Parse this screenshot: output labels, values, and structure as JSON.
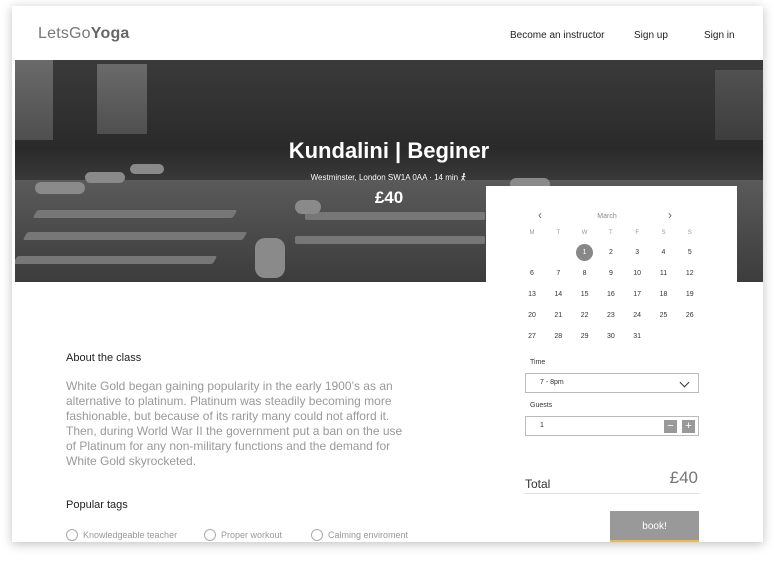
{
  "header": {
    "logo_light": "LetsGo",
    "logo_bold": "Yoga",
    "nav": [
      {
        "label": "Become an instructor"
      },
      {
        "label": "Sign up"
      },
      {
        "label": "Sign in"
      }
    ]
  },
  "hero": {
    "title": "Kundalini | Beginer",
    "location": "Westminster, London SW1A 0AA · 14 min",
    "price": "£40"
  },
  "about": {
    "heading": "About the class",
    "text": "White Gold began gaining popularity in the early 1900’s as an alternative to platinum. Platinum was steadily becoming more fashionable, but because of its rarity many could not afford it. Then, during World War II the government put a ban on the use of Platinum for any non-military functions and the demand for White Gold skyrocketed."
  },
  "tags": {
    "heading": "Popular tags",
    "items": [
      {
        "label": "Knowledgeable teacher",
        "icon": "chat-icon"
      },
      {
        "label": "Proper workout",
        "icon": "dumbbell-icon"
      },
      {
        "label": "Calming enviroment",
        "icon": "leaf-icon"
      }
    ]
  },
  "booking": {
    "calendar": {
      "month": "March",
      "weekdays": [
        "M",
        "T",
        "W",
        "T",
        "F",
        "S",
        "S"
      ],
      "weeks": [
        [
          "",
          "",
          "1",
          "2",
          "3",
          "4",
          "5"
        ],
        [
          "6",
          "7",
          "8",
          "9",
          "10",
          "11",
          "12"
        ],
        [
          "13",
          "14",
          "15",
          "16",
          "17",
          "18",
          "19"
        ],
        [
          "20",
          "21",
          "22",
          "23",
          "24",
          "25",
          "26"
        ],
        [
          "27",
          "28",
          "29",
          "30",
          "31",
          "",
          ""
        ]
      ],
      "selected": "1"
    },
    "time": {
      "label": "Time",
      "value": "7 - 8pm"
    },
    "guests": {
      "label": "Guests",
      "value": "1",
      "minus": "−",
      "plus": "+"
    },
    "total": {
      "label": "Total",
      "value": "£40"
    },
    "book_label": "book!"
  },
  "colors": {
    "accent_underline": "#e8b84a",
    "button_gray": "#999999"
  }
}
